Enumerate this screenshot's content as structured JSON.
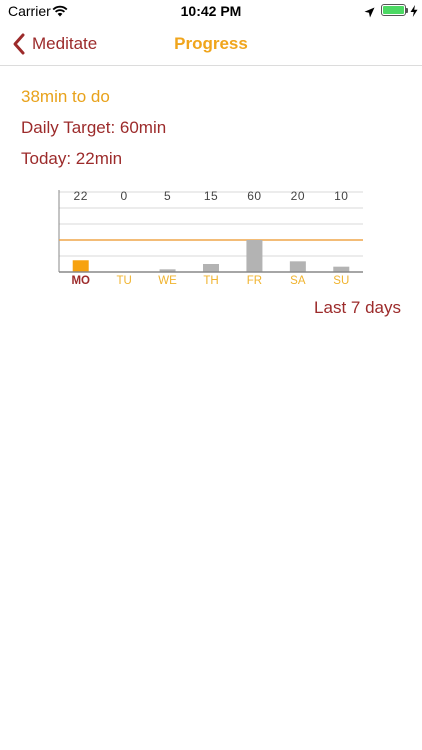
{
  "status_bar": {
    "carrier": "Carrier",
    "time": "10:42 PM",
    "battery_color": "#4cd964"
  },
  "nav": {
    "back_label": "Meditate",
    "title": "Progress"
  },
  "summary": {
    "to_do": "38min to do",
    "daily_target": "Daily Target: 60min",
    "today": "Today: 22min"
  },
  "chart_data": {
    "type": "bar",
    "categories": [
      "MO",
      "TU",
      "WE",
      "TH",
      "FR",
      "SA",
      "SU"
    ],
    "values": [
      22,
      0,
      5,
      15,
      60,
      20,
      10
    ],
    "value_labels": [
      "22",
      "0",
      "5",
      "15",
      "60",
      "20",
      "10"
    ],
    "target": 60,
    "ylim": [
      0,
      150
    ],
    "highlight_index": 0,
    "colors": {
      "today_bar": "#f7a20f",
      "bar": "#b3b3b3",
      "target_line": "#efa54a",
      "today_label": "#9c2b2b",
      "label": "#f0b32e",
      "value_label": "#444444",
      "grid": "#d9d9d9",
      "axis": "#888888"
    }
  },
  "footer": {
    "period": "Last 7 days"
  }
}
